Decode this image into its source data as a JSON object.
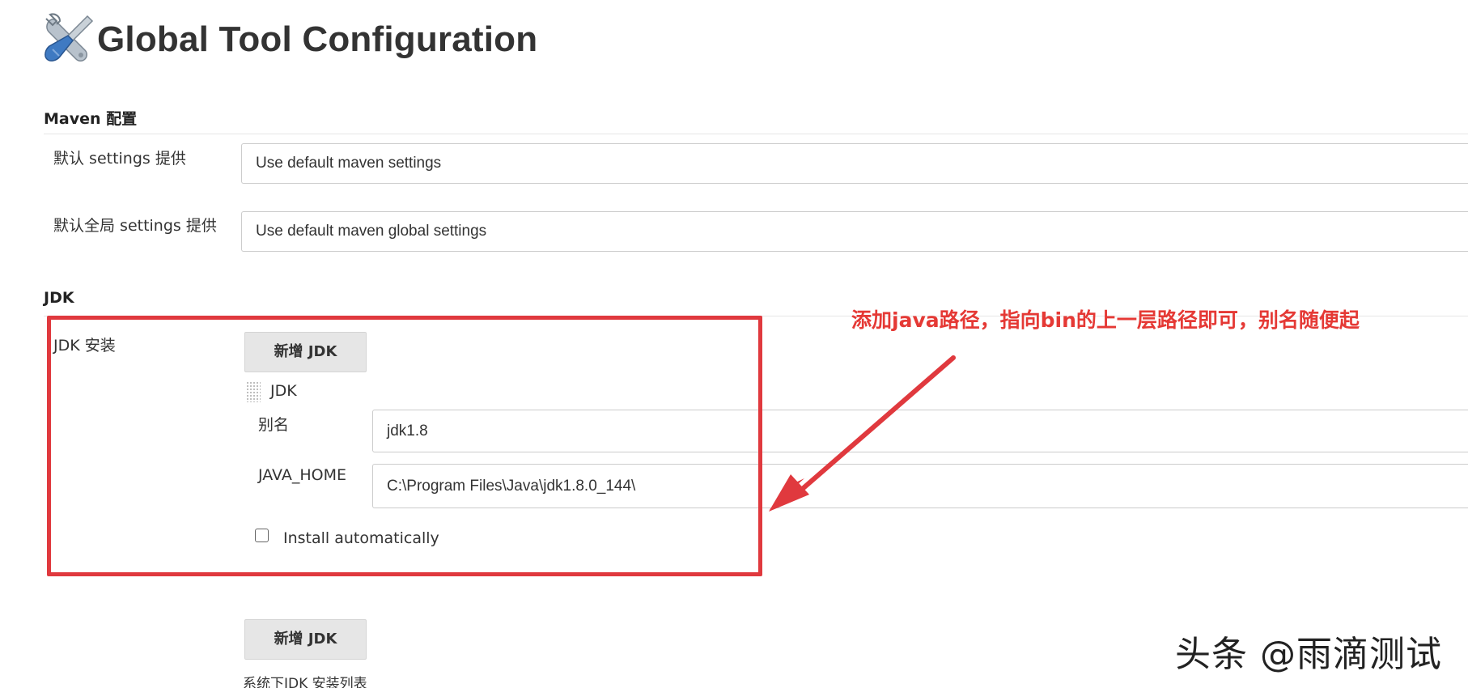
{
  "page_title": "Global Tool Configuration",
  "maven": {
    "heading": "Maven 配置",
    "default_settings": {
      "label": "默认 settings 提供",
      "value": "Use default maven settings"
    },
    "global_settings": {
      "label": "默认全局 settings 提供",
      "value": "Use default maven global settings"
    }
  },
  "jdk": {
    "heading": "JDK",
    "install_label": "JDK 安装",
    "add_button_label": "新增 JDK",
    "entry": {
      "title": "JDK",
      "alias_label": "别名",
      "alias_value": "jdk1.8",
      "java_home_label": "JAVA_HOME",
      "java_home_value": "C:\\Program Files\\Java\\jdk1.8.0_144\\",
      "install_automatically_label": "Install automatically",
      "install_automatically_checked": false
    },
    "add_button_label_bottom": "新增 JDK",
    "installations_list_caption": "系统下JDK 安装列表"
  },
  "annotation": {
    "text": "添加java路径，指向bin的上一层路径即可，别名随便起",
    "color": "#e53935"
  },
  "watermark": "头条 @雨滴测试",
  "icons": {
    "header_icon": "tools-icon"
  }
}
